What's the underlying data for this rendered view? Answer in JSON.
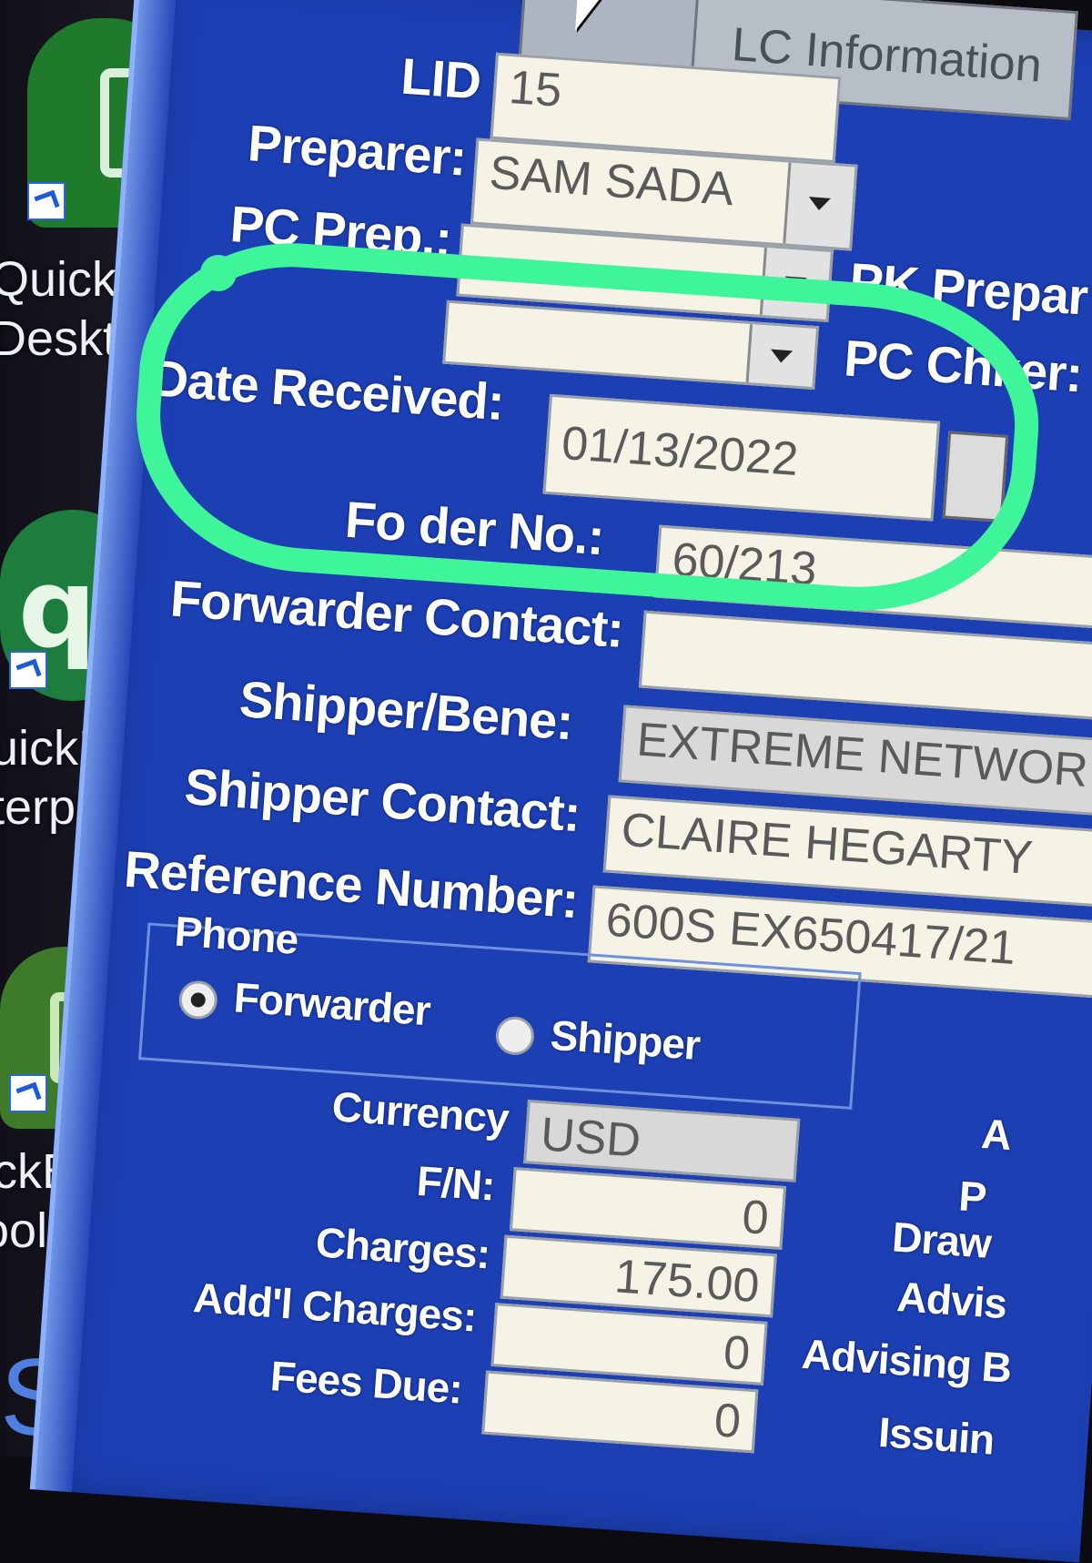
{
  "desktop": {
    "icons": [
      {
        "name": "quickbooks-desktop",
        "label_line1": "QuickB",
        "label_line2": "Deskto"
      },
      {
        "name": "quickbooks-enterprise",
        "label_line1": "uickBo",
        "label_line2": "terpri"
      },
      {
        "name": "quickbooks-tool-hub",
        "label_line1": "ickBo",
        "label_line2": "ool H"
      }
    ],
    "partial_letter": "S"
  },
  "window": {
    "tab_label": "LC Information",
    "form": {
      "lid": {
        "label": "LID",
        "value": "15"
      },
      "preparer": {
        "label": "Preparer:",
        "value": "SAM SADA"
      },
      "pc_prep": {
        "label": "PC Prep.:",
        "value": ""
      },
      "pk_preparer": {
        "label": "PK Prepar"
      },
      "pc_chker": {
        "label": "PC Chker:",
        "value": ""
      },
      "date_received": {
        "label": "Date Received:",
        "value": "01/13/2022"
      },
      "forwarder_no": {
        "label": "Fo           der No.:",
        "value": "60/213"
      },
      "forwarder_contact": {
        "label": "Forwarder Contact:",
        "value": ""
      },
      "shipper_bene": {
        "label": "Shipper/Bene:",
        "value": "EXTREME NETWOR"
      },
      "shipper_contact": {
        "label": "Shipper Contact:",
        "value": "CLAIRE HEGARTY"
      },
      "reference_number": {
        "label": "Reference Number:",
        "value": "600S EX650417/21"
      },
      "phone": {
        "label": "Phone",
        "options": [
          {
            "label": "Forwarder",
            "selected": true
          },
          {
            "label": "Shipper",
            "selected": false
          }
        ]
      },
      "currency": {
        "label": "Currency",
        "value": "USD"
      },
      "fn": {
        "label": "F/N:",
        "value": "0"
      },
      "charges": {
        "label": "Charges:",
        "value": "175.00"
      },
      "addl_charges": {
        "label": "Add'l Charges:",
        "value": "0"
      },
      "fees_due": {
        "label": "Fees Due:",
        "value": "0"
      }
    },
    "right_column_labels": [
      "A",
      "P",
      "Draw",
      "Advis",
      "Advising B",
      "Issuin"
    ]
  },
  "colors": {
    "window_bg": "#1c3fb4",
    "highlight": "#3ff59a",
    "field_bg": "#f5f3e6"
  }
}
